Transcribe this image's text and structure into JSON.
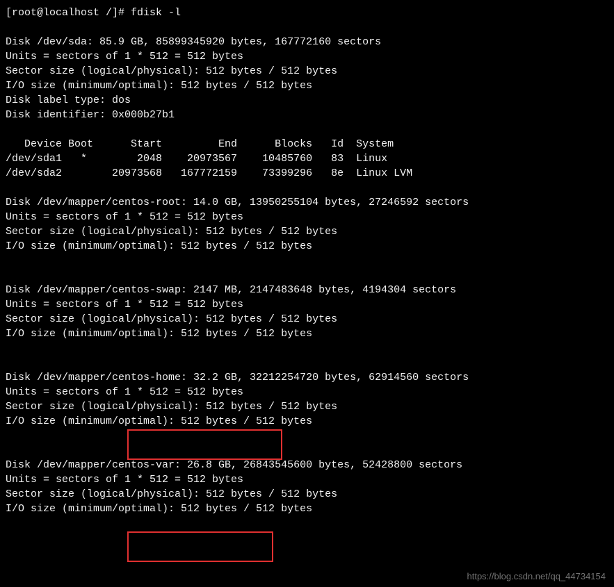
{
  "prompt": {
    "user_host": "[root@localhost /]#",
    "command": "fdisk -l"
  },
  "disk_sda": {
    "header": "Disk /dev/sda: 85.9 GB, 85899345920 bytes, 167772160 sectors",
    "units": "Units = sectors of 1 * 512 = 512 bytes",
    "sector_size": "Sector size (logical/physical): 512 bytes / 512 bytes",
    "io_size": "I/O size (minimum/optimal): 512 bytes / 512 bytes",
    "label_type": "Disk label type: dos",
    "identifier": "Disk identifier: 0x000b27b1"
  },
  "partition_table": {
    "header": "   Device Boot      Start         End      Blocks   Id  System",
    "row1": "/dev/sda1   *        2048    20973567    10485760   83  Linux",
    "row2": "/dev/sda2        20973568   167772159    73399296   8e  Linux LVM"
  },
  "disk_root": {
    "header": "Disk /dev/mapper/centos-root: 14.0 GB, 13950255104 bytes, 27246592 sectors",
    "units": "Units = sectors of 1 * 512 = 512 bytes",
    "sector_size": "Sector size (logical/physical): 512 bytes / 512 bytes",
    "io_size": "I/O size (minimum/optimal): 512 bytes / 512 bytes"
  },
  "disk_swap": {
    "header": "Disk /dev/mapper/centos-swap: 2147 MB, 2147483648 bytes, 4194304 sectors",
    "units": "Units = sectors of 1 * 512 = 512 bytes",
    "sector_size": "Sector size (logical/physical): 512 bytes / 512 bytes",
    "io_size": "I/O size (minimum/optimal): 512 bytes / 512 bytes"
  },
  "disk_home": {
    "header": "Disk /dev/mapper/centos-home: 32.2 GB, 32212254720 bytes, 62914560 sectors",
    "units": "Units = sectors of 1 * 512 = 512 bytes",
    "sector_size": "Sector size (logical/physical): 512 bytes / 512 bytes",
    "io_size": "I/O size (minimum/optimal): 512 bytes / 512 bytes"
  },
  "disk_var": {
    "header": "Disk /dev/mapper/centos-var: 26.8 GB, 26843545600 bytes, 52428800 sectors",
    "units": "Units = sectors of 1 * 512 = 512 bytes",
    "sector_size": "Sector size (logical/physical): 512 bytes / 512 bytes",
    "io_size": "I/O size (minimum/optimal): 512 bytes / 512 bytes"
  },
  "watermark": "https://blog.csdn.net/qq_44734154",
  "highlights": [
    {
      "label": "centos-home: 32.2 GB,"
    },
    {
      "label": "centos-var: 26.8 GB"
    }
  ]
}
